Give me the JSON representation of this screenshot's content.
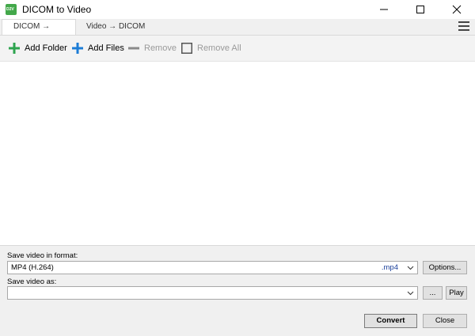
{
  "window": {
    "title": "DICOM to Video",
    "icon_text": "D2V",
    "icon_color": "#43a84a",
    "controls": [
      "minimize-icon",
      "maximize-icon",
      "close-icon"
    ]
  },
  "tabs": [
    {
      "label": "DICOM → Video",
      "active": true
    },
    {
      "label": "Video → DICOM",
      "active": false
    }
  ],
  "menu_icon": "hamburger-menu-icon",
  "toolbar": {
    "add_folder": "Add Folder",
    "add_files": "Add Files",
    "remove": "Remove",
    "remove_all": "Remove All",
    "plus_green": "#2ea44f",
    "plus_blue": "#1c7cd6"
  },
  "format": {
    "label": "Save video in format:",
    "value": "MP4 (H.264)",
    "extension": ".mp4",
    "options_button": "Options..."
  },
  "save_as": {
    "label": "Save video as:",
    "value": "",
    "browse_button": "...",
    "play_button": "Play"
  },
  "actions": {
    "convert": "Convert",
    "close": "Close"
  }
}
